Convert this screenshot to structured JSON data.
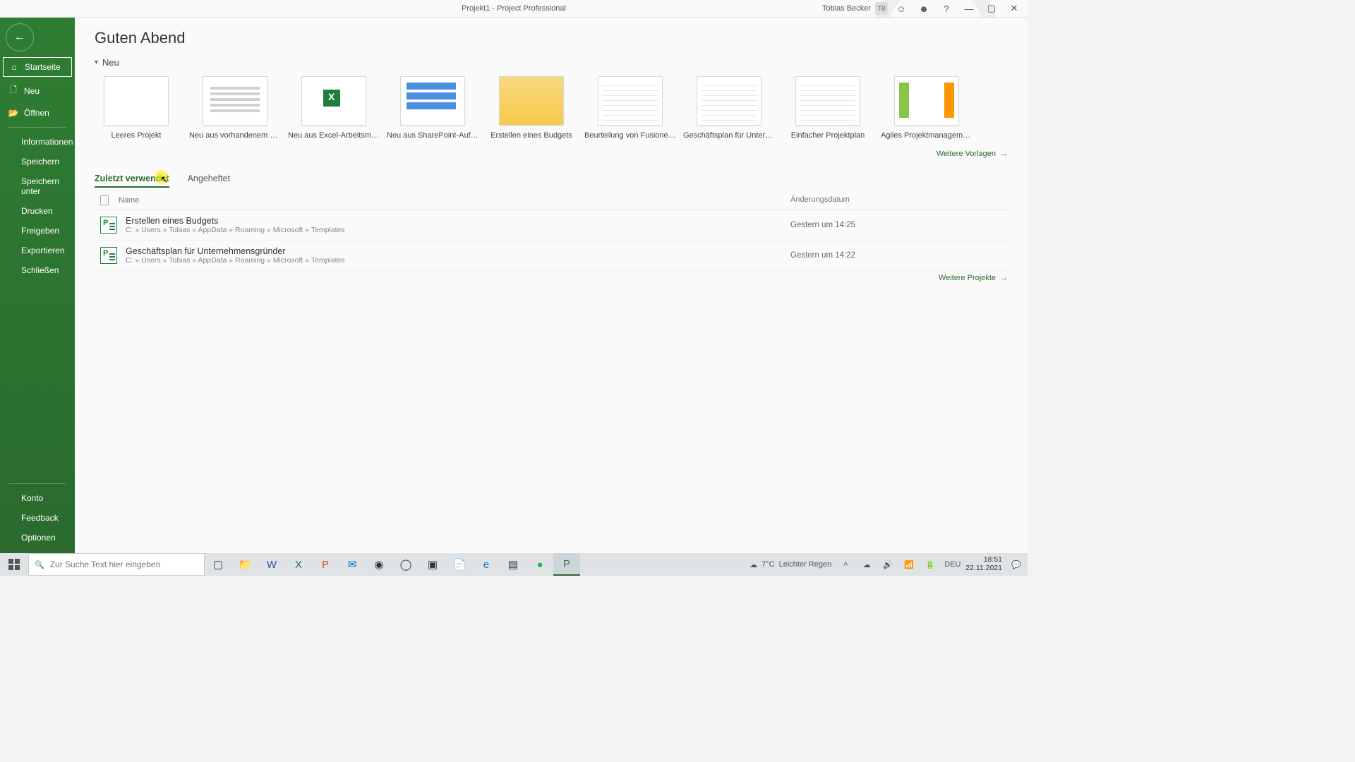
{
  "titlebar": {
    "document": "Projekt1",
    "sep": " - ",
    "app": "Project Professional",
    "user": "Tobias Becker",
    "initials": "TB"
  },
  "sidebar": {
    "primary": [
      {
        "key": "home",
        "label": "Startseite",
        "icon": "⌂",
        "active": true
      },
      {
        "key": "new",
        "label": "Neu",
        "icon": "🗋"
      },
      {
        "key": "open",
        "label": "Öffnen",
        "icon": "📂"
      }
    ],
    "secondary": [
      {
        "key": "info",
        "label": "Informationen"
      },
      {
        "key": "save",
        "label": "Speichern"
      },
      {
        "key": "saveas",
        "label": "Speichern unter"
      },
      {
        "key": "print",
        "label": "Drucken"
      },
      {
        "key": "share",
        "label": "Freigeben"
      },
      {
        "key": "export",
        "label": "Exportieren"
      },
      {
        "key": "close",
        "label": "Schließen"
      }
    ],
    "bottom": [
      {
        "key": "account",
        "label": "Konto"
      },
      {
        "key": "feedback",
        "label": "Feedback"
      },
      {
        "key": "options",
        "label": "Optionen"
      }
    ]
  },
  "main": {
    "greeting": "Guten Abend",
    "section_new": "Neu",
    "templates": [
      {
        "label": "Leeres Projekt",
        "thumb": ""
      },
      {
        "label": "Neu aus vorhandenem Projekt",
        "thumb": "lines"
      },
      {
        "label": "Neu aus Excel-Arbeitsmappe",
        "thumb": "excel"
      },
      {
        "label": "Neu aus SharePoint-Aufgab...",
        "thumb": "gantt"
      },
      {
        "label": "Erstellen eines Budgets",
        "thumb": "budget"
      },
      {
        "label": "Beurteilung von Fusionen un...",
        "thumb": "grid"
      },
      {
        "label": "Geschäftsplan für Unterneh...",
        "thumb": "grid"
      },
      {
        "label": "Einfacher Projektplan",
        "thumb": "grid"
      },
      {
        "label": "Agiles Projektmanagement",
        "thumb": "agile"
      }
    ],
    "more_templates": "Weitere Vorlagen",
    "tabs": {
      "recent": "Zuletzt verwendet",
      "pinned": "Angeheftet"
    },
    "columns": {
      "name": "Name",
      "date": "Änderungsdatum"
    },
    "recent": [
      {
        "name": "Erstellen eines Budgets",
        "path": "C: » Users » Tobias » AppData » Roaming » Microsoft » Templates",
        "date": "Gestern um 14:25"
      },
      {
        "name": "Geschäftsplan für Unternehmensgründer",
        "path": "C: » Users » Tobias » AppData » Roaming » Microsoft » Templates",
        "date": "Gestern um 14:22"
      }
    ],
    "more_projects": "Weitere Projekte"
  },
  "taskbar": {
    "search_placeholder": "Zur Suche Text hier eingeben",
    "weather": {
      "temp": "7°C",
      "text": "Leichter Regen"
    },
    "lang": "DEU",
    "time": "18:51",
    "date": "22.11.2021"
  }
}
